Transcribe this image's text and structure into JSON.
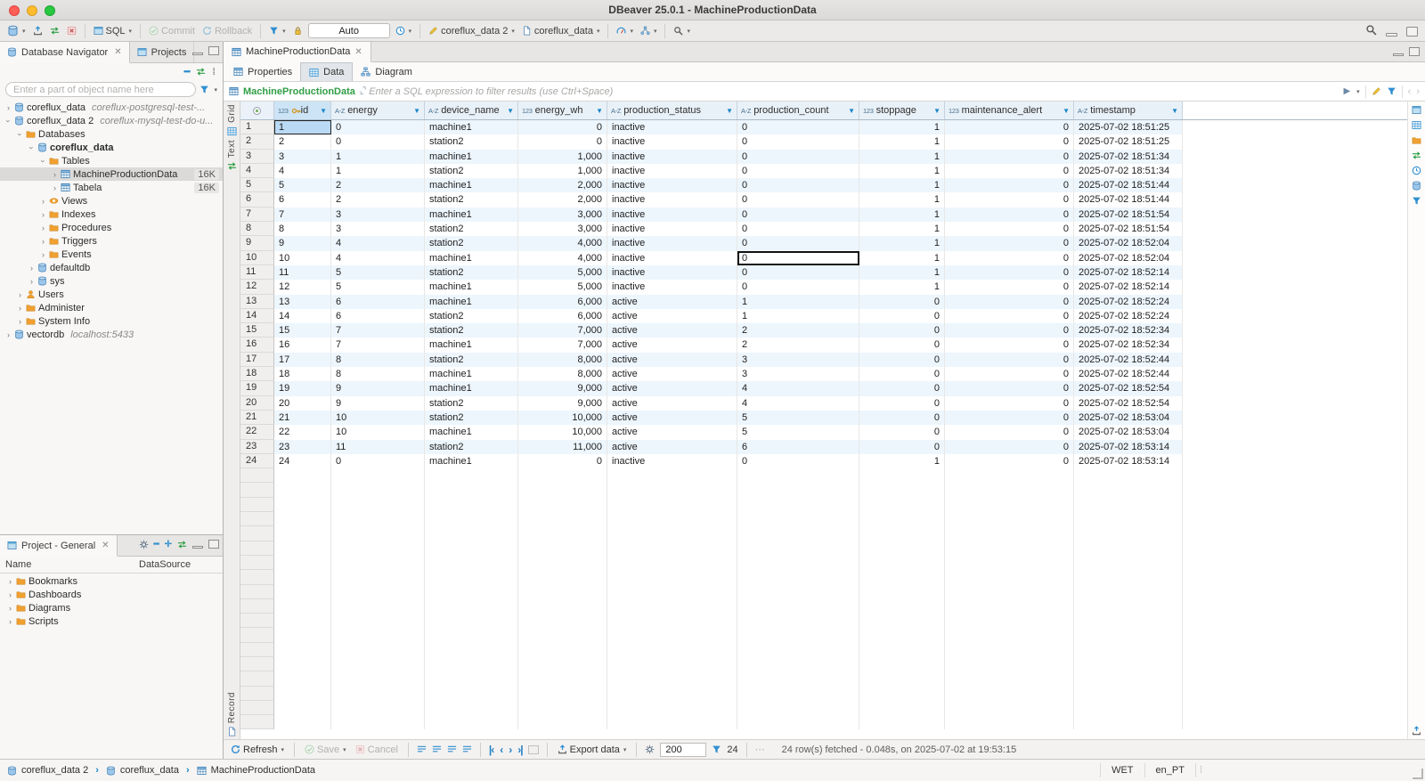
{
  "window": {
    "title": "DBeaver 25.0.1 - MachineProductionData"
  },
  "colors": {
    "accent_blue": "#2f8fd0",
    "table_name_green": "#2f9e44",
    "row_stripe": "#edf6fd",
    "selection_fill": "#b9d9f4",
    "folder_orange": "#f0a030"
  },
  "toolbar": {
    "sql": "SQL",
    "commit": "Commit",
    "rollback": "Rollback",
    "auto": "Auto",
    "connection": "coreflux_data 2",
    "database": "coreflux_data"
  },
  "navigator": {
    "tab_database": "Database Navigator",
    "tab_projects": "Projects",
    "filter_placeholder": "Enter a part of object name here",
    "tree": [
      {
        "level": 0,
        "exp": "collapsed",
        "icon": "db",
        "label": "coreflux_data",
        "detail": "coreflux-postgresql-test-..."
      },
      {
        "level": 0,
        "exp": "expanded",
        "icon": "db",
        "label": "coreflux_data 2",
        "detail": "coreflux-mysql-test-do-u..."
      },
      {
        "level": 1,
        "exp": "expanded",
        "icon": "folder",
        "label": "Databases"
      },
      {
        "level": 2,
        "exp": "expanded",
        "icon": "db",
        "label": "coreflux_data",
        "bold": true
      },
      {
        "level": 3,
        "exp": "expanded",
        "icon": "folder",
        "label": "Tables"
      },
      {
        "level": 4,
        "exp": "collapsed",
        "icon": "table",
        "label": "MachineProductionData",
        "badge": "16K",
        "selected": true
      },
      {
        "level": 4,
        "exp": "collapsed",
        "icon": "table",
        "label": "Tabela",
        "badge": "16K"
      },
      {
        "level": 3,
        "exp": "collapsed",
        "icon": "eye",
        "label": "Views"
      },
      {
        "level": 3,
        "exp": "collapsed",
        "icon": "folder",
        "label": "Indexes"
      },
      {
        "level": 3,
        "exp": "collapsed",
        "icon": "folder",
        "label": "Procedures"
      },
      {
        "level": 3,
        "exp": "collapsed",
        "icon": "folder",
        "label": "Triggers"
      },
      {
        "level": 3,
        "exp": "collapsed",
        "icon": "folder",
        "label": "Events"
      },
      {
        "level": 2,
        "exp": "collapsed",
        "icon": "db",
        "label": "defaultdb"
      },
      {
        "level": 2,
        "exp": "collapsed",
        "icon": "db",
        "label": "sys"
      },
      {
        "level": 1,
        "exp": "collapsed",
        "icon": "user",
        "label": "Users"
      },
      {
        "level": 1,
        "exp": "collapsed",
        "icon": "folder",
        "label": "Administer"
      },
      {
        "level": 1,
        "exp": "collapsed",
        "icon": "folder",
        "label": "System Info"
      },
      {
        "level": 0,
        "exp": "collapsed",
        "icon": "db",
        "label": "vectordb",
        "detail": "localhost:5433"
      }
    ]
  },
  "project_panel": {
    "tab": "Project - General",
    "col_name": "Name",
    "col_datasource": "DataSource",
    "items": [
      {
        "icon": "folder",
        "label": "Bookmarks"
      },
      {
        "icon": "folder",
        "label": "Dashboards"
      },
      {
        "icon": "folder",
        "label": "Diagrams"
      },
      {
        "icon": "folder",
        "label": "Scripts"
      }
    ]
  },
  "editor": {
    "tab": "MachineProductionData",
    "subtabs": [
      "Properties",
      "Data",
      "Diagram"
    ],
    "active_subtab": "Data",
    "filter_table": "MachineProductionData",
    "filter_placeholder": "Enter a SQL expression to filter results (use Ctrl+Space)",
    "side_tab_grid": "Grid",
    "side_tab_text": "Text",
    "side_tab_record": "Record"
  },
  "grid": {
    "columns": [
      {
        "type": "123",
        "name": "id",
        "key": true
      },
      {
        "type": "A-Z",
        "name": "energy"
      },
      {
        "type": "A-Z",
        "name": "device_name"
      },
      {
        "type": "123",
        "name": "energy_wh"
      },
      {
        "type": "A-Z",
        "name": "production_status"
      },
      {
        "type": "A-Z",
        "name": "production_count"
      },
      {
        "type": "123",
        "name": "stoppage"
      },
      {
        "type": "123",
        "name": "maintenance_alert"
      },
      {
        "type": "A-Z",
        "name": "timestamp"
      }
    ],
    "rows": [
      [
        "1",
        "0",
        "machine1",
        "0",
        "inactive",
        "0",
        "1",
        "0",
        "2025-07-02 18:51:25"
      ],
      [
        "2",
        "0",
        "station2",
        "0",
        "inactive",
        "0",
        "1",
        "0",
        "2025-07-02 18:51:25"
      ],
      [
        "3",
        "1",
        "machine1",
        "1,000",
        "inactive",
        "0",
        "1",
        "0",
        "2025-07-02 18:51:34"
      ],
      [
        "4",
        "1",
        "station2",
        "1,000",
        "inactive",
        "0",
        "1",
        "0",
        "2025-07-02 18:51:34"
      ],
      [
        "5",
        "2",
        "machine1",
        "2,000",
        "inactive",
        "0",
        "1",
        "0",
        "2025-07-02 18:51:44"
      ],
      [
        "6",
        "2",
        "station2",
        "2,000",
        "inactive",
        "0",
        "1",
        "0",
        "2025-07-02 18:51:44"
      ],
      [
        "7",
        "3",
        "machine1",
        "3,000",
        "inactive",
        "0",
        "1",
        "0",
        "2025-07-02 18:51:54"
      ],
      [
        "8",
        "3",
        "station2",
        "3,000",
        "inactive",
        "0",
        "1",
        "0",
        "2025-07-02 18:51:54"
      ],
      [
        "9",
        "4",
        "station2",
        "4,000",
        "inactive",
        "0",
        "1",
        "0",
        "2025-07-02 18:52:04"
      ],
      [
        "10",
        "4",
        "machine1",
        "4,000",
        "inactive",
        "0",
        "1",
        "0",
        "2025-07-02 18:52:04"
      ],
      [
        "11",
        "5",
        "station2",
        "5,000",
        "inactive",
        "0",
        "1",
        "0",
        "2025-07-02 18:52:14"
      ],
      [
        "12",
        "5",
        "machine1",
        "5,000",
        "inactive",
        "0",
        "1",
        "0",
        "2025-07-02 18:52:14"
      ],
      [
        "13",
        "6",
        "machine1",
        "6,000",
        "active",
        "1",
        "0",
        "0",
        "2025-07-02 18:52:24"
      ],
      [
        "14",
        "6",
        "station2",
        "6,000",
        "active",
        "1",
        "0",
        "0",
        "2025-07-02 18:52:24"
      ],
      [
        "15",
        "7",
        "station2",
        "7,000",
        "active",
        "2",
        "0",
        "0",
        "2025-07-02 18:52:34"
      ],
      [
        "16",
        "7",
        "machine1",
        "7,000",
        "active",
        "2",
        "0",
        "0",
        "2025-07-02 18:52:34"
      ],
      [
        "17",
        "8",
        "station2",
        "8,000",
        "active",
        "3",
        "0",
        "0",
        "2025-07-02 18:52:44"
      ],
      [
        "18",
        "8",
        "machine1",
        "8,000",
        "active",
        "3",
        "0",
        "0",
        "2025-07-02 18:52:44"
      ],
      [
        "19",
        "9",
        "machine1",
        "9,000",
        "active",
        "4",
        "0",
        "0",
        "2025-07-02 18:52:54"
      ],
      [
        "20",
        "9",
        "station2",
        "9,000",
        "active",
        "4",
        "0",
        "0",
        "2025-07-02 18:52:54"
      ],
      [
        "21",
        "10",
        "station2",
        "10,000",
        "active",
        "5",
        "0",
        "0",
        "2025-07-02 18:53:04"
      ],
      [
        "22",
        "10",
        "machine1",
        "10,000",
        "active",
        "5",
        "0",
        "0",
        "2025-07-02 18:53:04"
      ],
      [
        "23",
        "11",
        "station2",
        "11,000",
        "active",
        "6",
        "0",
        "0",
        "2025-07-02 18:53:14"
      ],
      [
        "24",
        "0",
        "machine1",
        "0",
        "inactive",
        "0",
        "1",
        "0",
        "2025-07-02 18:53:14"
      ]
    ],
    "selected_cell": {
      "row": 1,
      "column": "id"
    },
    "focused_cell": {
      "row": 10,
      "column": "production_count"
    }
  },
  "result_toolbar": {
    "refresh": "Refresh",
    "save": "Save",
    "cancel": "Cancel",
    "export": "Export data",
    "fetch_size": "200",
    "visible_rows": "24",
    "status": "24 row(s) fetched - 0.048s, on 2025-07-02 at 19:53:15"
  },
  "statusbar": {
    "breadcrumbs": [
      "coreflux_data 2",
      "coreflux_data",
      "MachineProductionData"
    ],
    "timezone": "WET",
    "locale": "en_PT"
  }
}
